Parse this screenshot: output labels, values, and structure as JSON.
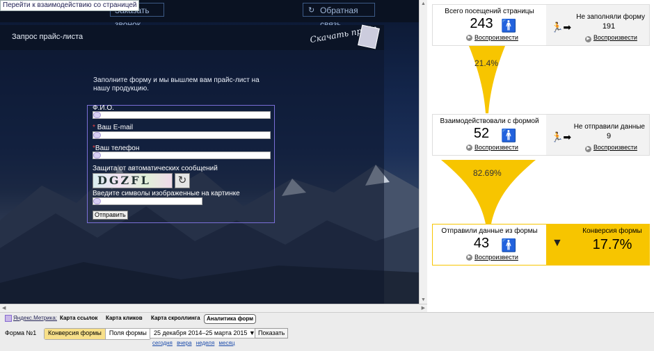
{
  "site": {
    "linkbar": "Перейти к взаимодействию со страницей",
    "callback": "Заказать звонок",
    "feedback": "Обратная связь",
    "header_title": "Запрос прайс-листа",
    "price_btn": "Скачать прайс",
    "intro": "Заполните форму и мы вышлем вам прайс-лист на нашу продукцию.",
    "fields": {
      "name_label": "Ф.И.О.",
      "email_label": "Ваш E-mail",
      "phone_label": "Ваш телефон",
      "captcha_label": "Защита от автоматических сообщений",
      "captcha_text": "DGZFL",
      "captcha_hint": "Введите символы изображенные на картинке"
    },
    "submit": "Отправить"
  },
  "analytics": {
    "visits": {
      "title": "Всего посещений страницы",
      "value": "243",
      "play": "Воспроизвести"
    },
    "not_filled": {
      "title": "Не заполняли форму",
      "value": "191",
      "play": "Воспроизвести"
    },
    "pct1": "21.4%",
    "interacted": {
      "title": "Взаимодействовали с формой",
      "value": "52",
      "play": "Воспроизвести"
    },
    "not_sent": {
      "title": "Не отправили данные",
      "value": "9",
      "play": "Воспроизвести"
    },
    "pct2": "82.69%",
    "sent": {
      "title": "Отправили данные из формы",
      "value": "43",
      "play": "Воспроизвести"
    },
    "conversion": {
      "title": "Конверсия формы",
      "value": "17.7%"
    },
    "accent": "#f7c500"
  },
  "bottom": {
    "metrika": "Яндекс.Метрика:",
    "tabs": [
      "Карта ссылок",
      "Карта кликов",
      "Карта скроллинга",
      "Аналитика форм"
    ],
    "form_name": "Форма №1",
    "seg_conversion": "Конверсия формы",
    "seg_fields": "Поля формы",
    "date_range": "25 декабря 2014–25 марта 2015 ▼",
    "show": "Показать",
    "quick": [
      "сегодня",
      "вчера",
      "неделя",
      "месяц"
    ]
  }
}
